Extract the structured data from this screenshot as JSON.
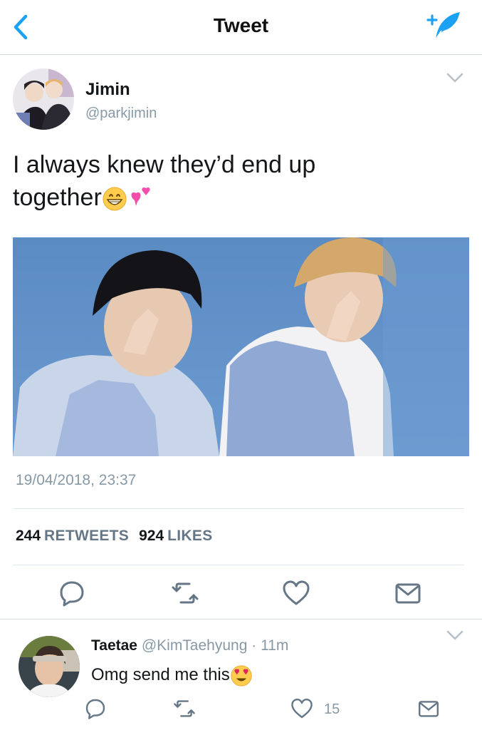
{
  "nav": {
    "title": "Tweet",
    "back_icon": "chevron-left-icon",
    "compose_icon": "compose-tweet-icon",
    "accent": "#1da1f2"
  },
  "tweet": {
    "author_name": "Jimin",
    "author_handle": "@parkjimin",
    "text_line1": "I always knew they’d end up",
    "text_line2": "together",
    "emojis": [
      "grinning-face",
      "two-hearts"
    ],
    "timestamp": "19/04/2018, 23:37",
    "retweet_count": "244",
    "retweet_label": "RETWEETS",
    "like_count": "924",
    "like_label": "LIKES",
    "actions": [
      "reply-icon",
      "retweet-icon",
      "like-icon",
      "message-icon"
    ]
  },
  "reply": {
    "name": "Taetae",
    "handle": "@KimTaehyung",
    "separator": "·",
    "time": "11m",
    "text": "Omg send me this",
    "emoji": "heart-eyes-face",
    "like_count": "15"
  }
}
